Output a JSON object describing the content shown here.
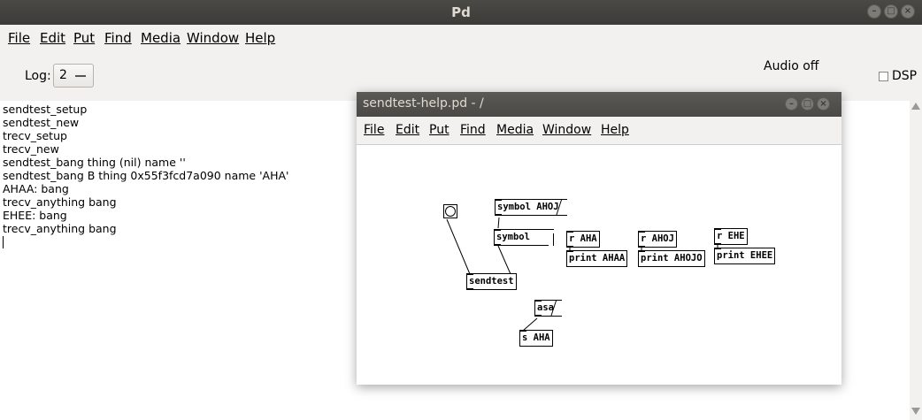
{
  "main_window": {
    "title": "Pd",
    "menu": [
      "File",
      "Edit",
      "Put",
      "Find",
      "Media",
      "Window",
      "Help"
    ],
    "log_label": "Log:",
    "log_level": "2",
    "audio_status": "Audio off",
    "dsp_label": "DSP",
    "console_lines": [
      "sendtest_setup",
      "sendtest_new",
      "trecv_setup",
      "trecv_new",
      "sendtest_bang thing (nil) name ''",
      "sendtest_bang B thing 0x55f3fcd7a090 name 'AHA'",
      "AHAA: bang",
      "trecv_anything bang",
      "EHEE: bang",
      "trecv_anything bang"
    ]
  },
  "patch_window": {
    "title": "sendtest-help.pd  - /",
    "menu": [
      "File",
      "Edit",
      "Put",
      "Find",
      "Media",
      "Window",
      "Help"
    ],
    "objects": {
      "msg_symbol_ahoj": "symbol AHOJ",
      "symbol_box": "symbol",
      "sendtest": "sendtest",
      "r_aha": "r AHA",
      "print_ahaa": "print AHAA",
      "r_ahoj": "r AHOJ",
      "print_ahojo": "print AHOJO",
      "r_ehe": "r EHE",
      "print_ehee": "print EHEE",
      "msg_asa": "asa",
      "s_aha": "s AHA"
    }
  }
}
